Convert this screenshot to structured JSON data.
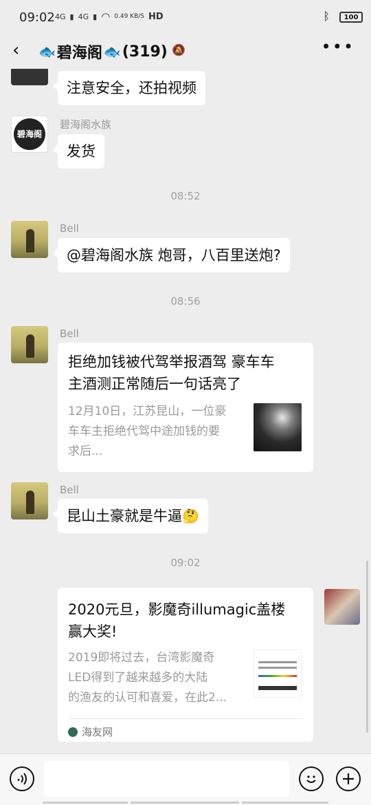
{
  "status_bar": {
    "time": "09:02",
    "signal1": "4G",
    "signal2": "4G",
    "speed": "0.49 KB/S",
    "hd": "HD",
    "battery": "100"
  },
  "header": {
    "back_icon": "chevron-left-icon",
    "fish_icon": "🐟",
    "title": "碧海阁",
    "count": "(319)",
    "mute_icon": "bell-off-icon",
    "more_icon": "more-icon"
  },
  "messages": {
    "m1": {
      "text": "注意安全，还拍视频"
    },
    "m2": {
      "sender": "碧海阁水族",
      "avatar_text": "碧海阁",
      "text": "发货"
    },
    "t1": "08:52",
    "m3": {
      "sender": "Bell",
      "text": "@碧海阁水族  炮哥，八百里送炮?"
    },
    "t2": "08:56",
    "m4": {
      "sender": "Bell",
      "title": "拒绝加钱被代驾举报酒驾 豪车车主酒测正常随后一句话亮了",
      "title_l1": "拒绝加钱被代驾举报酒驾 豪车车",
      "title_l2": "主酒测正常随后一句话亮了",
      "desc_l1": "12月10日，江苏昆山，一位豪",
      "desc_l2": "车车主拒绝代驾中途加钱的要",
      "desc_l3": "求后..."
    },
    "m5": {
      "sender": "Bell",
      "text": "昆山土豪就是牛逼",
      "emoji": "🤔"
    },
    "t3": "09:02",
    "m6": {
      "title_l1": "2020元旦，影魔奇illumagic盖楼",
      "title_l2": "赢大奖!",
      "desc_l1": "2019即将过去，台湾影魔奇",
      "desc_l2": "LED得到了越来越多的大陆",
      "desc_l3": "的渔友的认可和喜爱，在此2...",
      "source": "海友网"
    }
  },
  "input_bar": {
    "voice_icon": "voice-icon",
    "emoji_icon": "emoji-icon",
    "add_icon": "plus-icon"
  }
}
